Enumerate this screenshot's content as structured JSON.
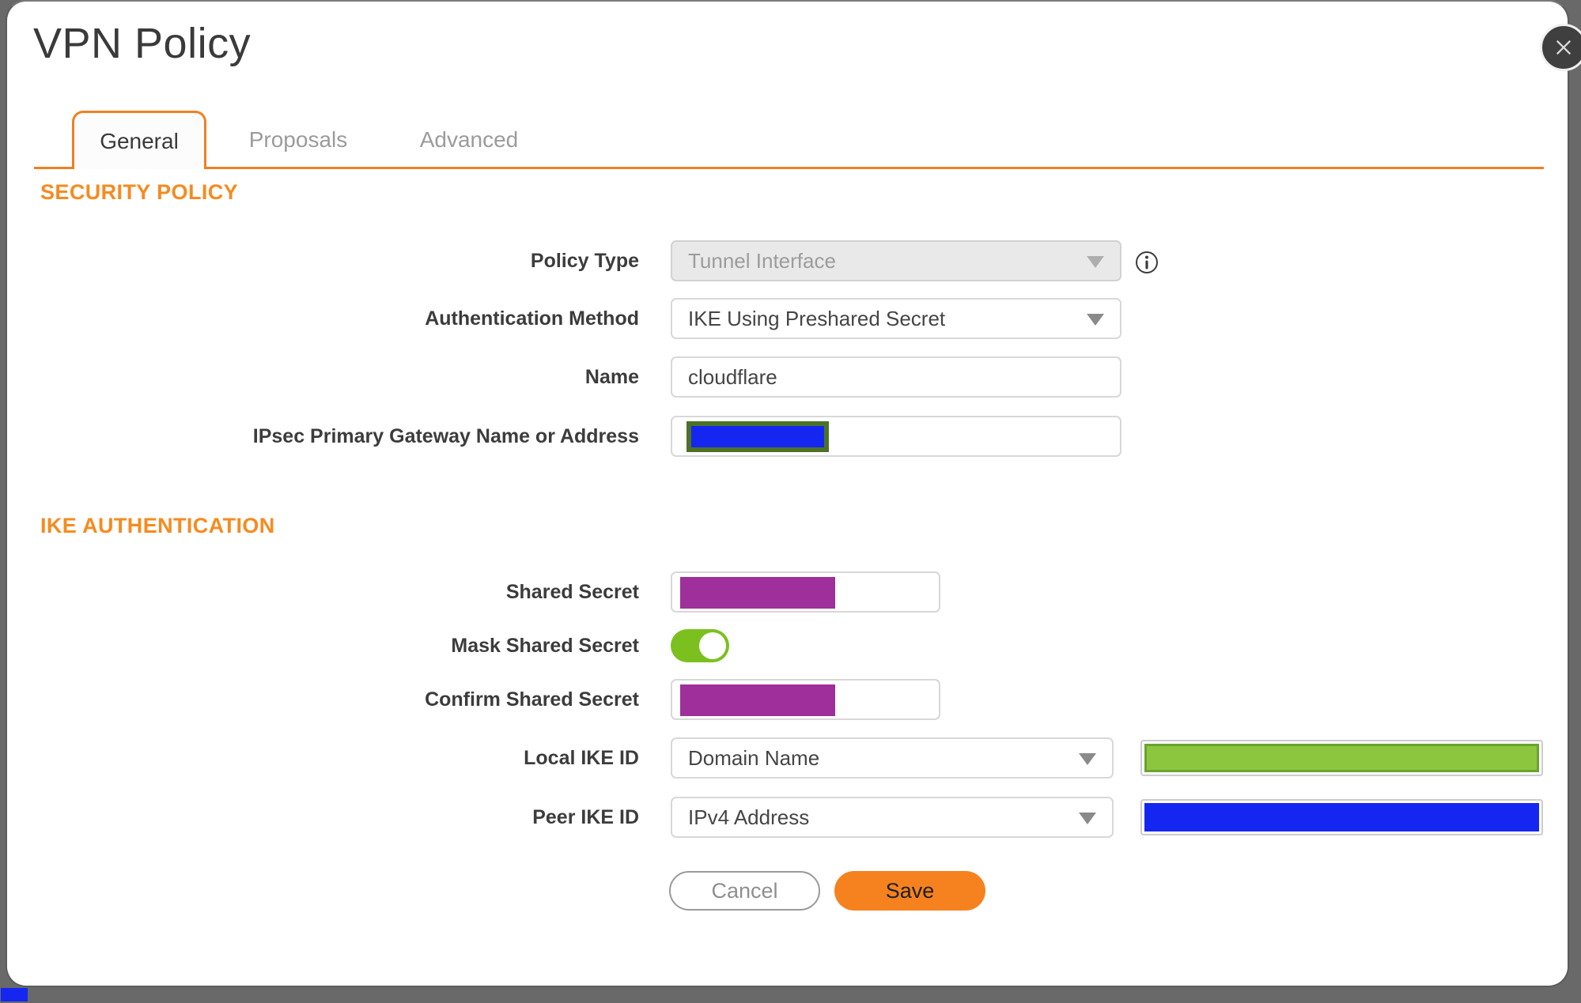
{
  "dialog": {
    "title": "VPN Policy"
  },
  "tabs": {
    "general": {
      "label": "General",
      "active": true
    },
    "proposals": {
      "label": "Proposals",
      "active": false
    },
    "advanced": {
      "label": "Advanced",
      "active": false
    }
  },
  "security_policy": {
    "heading": "SECURITY POLICY",
    "policy_type": {
      "label": "Policy Type",
      "value": "Tunnel Interface",
      "disabled": true
    },
    "authentication_method": {
      "label": "Authentication Method",
      "value": "IKE Using Preshared Secret"
    },
    "name": {
      "label": "Name",
      "value": "cloudflare"
    },
    "gateway": {
      "label": "IPsec Primary Gateway Name or Address",
      "redacted": true
    }
  },
  "ike_authentication": {
    "heading": "IKE AUTHENTICATION",
    "shared_secret": {
      "label": "Shared Secret",
      "redacted": true
    },
    "mask_shared_secret": {
      "label": "Mask Shared Secret",
      "enabled": true
    },
    "confirm_shared_secret": {
      "label": "Confirm Shared Secret",
      "redacted": true
    },
    "local_ike_id": {
      "label": "Local IKE ID",
      "value": "Domain Name",
      "id_redacted": true
    },
    "peer_ike_id": {
      "label": "Peer IKE ID",
      "value": "IPv4 Address",
      "id_redacted": true
    }
  },
  "buttons": {
    "cancel": "Cancel",
    "save": "Save"
  },
  "colors": {
    "accent_orange": "#f6821f",
    "tab_border_orange": "#ef8022",
    "section_heading_orange": "#f68b1f",
    "toggle_on_green": "#7cc01f",
    "redaction_purple": "#9e2f9b",
    "redaction_blue": "#1526f0",
    "redaction_green": "#8cc63e",
    "redaction_green_border": "#4c7228",
    "backdrop_gray": "#696969"
  }
}
